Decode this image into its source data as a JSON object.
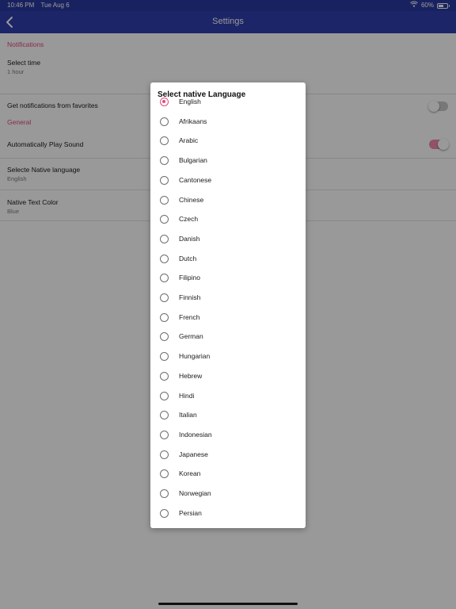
{
  "status_bar": {
    "time": "10:46 PM",
    "date": "Tue Aug 6",
    "battery": "60%",
    "battery_level": 0.6,
    "icons": [
      "wifi-icon",
      "battery-icon"
    ]
  },
  "nav": {
    "title": "Settings",
    "back_icon": "chevron-left-icon"
  },
  "colors": {
    "accent": "#e5497a",
    "nav_bg": "#2f3fae",
    "status_bg": "#2b3aa0"
  },
  "settings": {
    "notifications_header": "Notifications",
    "select_time": {
      "label": "Select time",
      "value": "1 hour"
    },
    "favorites": {
      "label": "Get notifications from favorites",
      "enabled": false
    },
    "general_header": "General",
    "auto_play": {
      "label": "Automatically Play Sound",
      "enabled": true
    },
    "native_language": {
      "label": "Selecte Native language",
      "value": "English"
    },
    "native_color": {
      "label": "Native Text Color",
      "value": "Blue"
    }
  },
  "dialog": {
    "title": "Select native Language",
    "selected": "English",
    "options": [
      "English",
      "Afrikaans",
      "Arabic",
      "Bulgarian",
      "Cantonese",
      "Chinese",
      "Czech",
      "Danish",
      "Dutch",
      "Filipino",
      "Finnish",
      "French",
      "German",
      "Hungarian",
      "Hebrew",
      "Hindi",
      "Italian",
      "Indonesian",
      "Japanese",
      "Korean",
      "Norwegian",
      "Persian"
    ]
  }
}
